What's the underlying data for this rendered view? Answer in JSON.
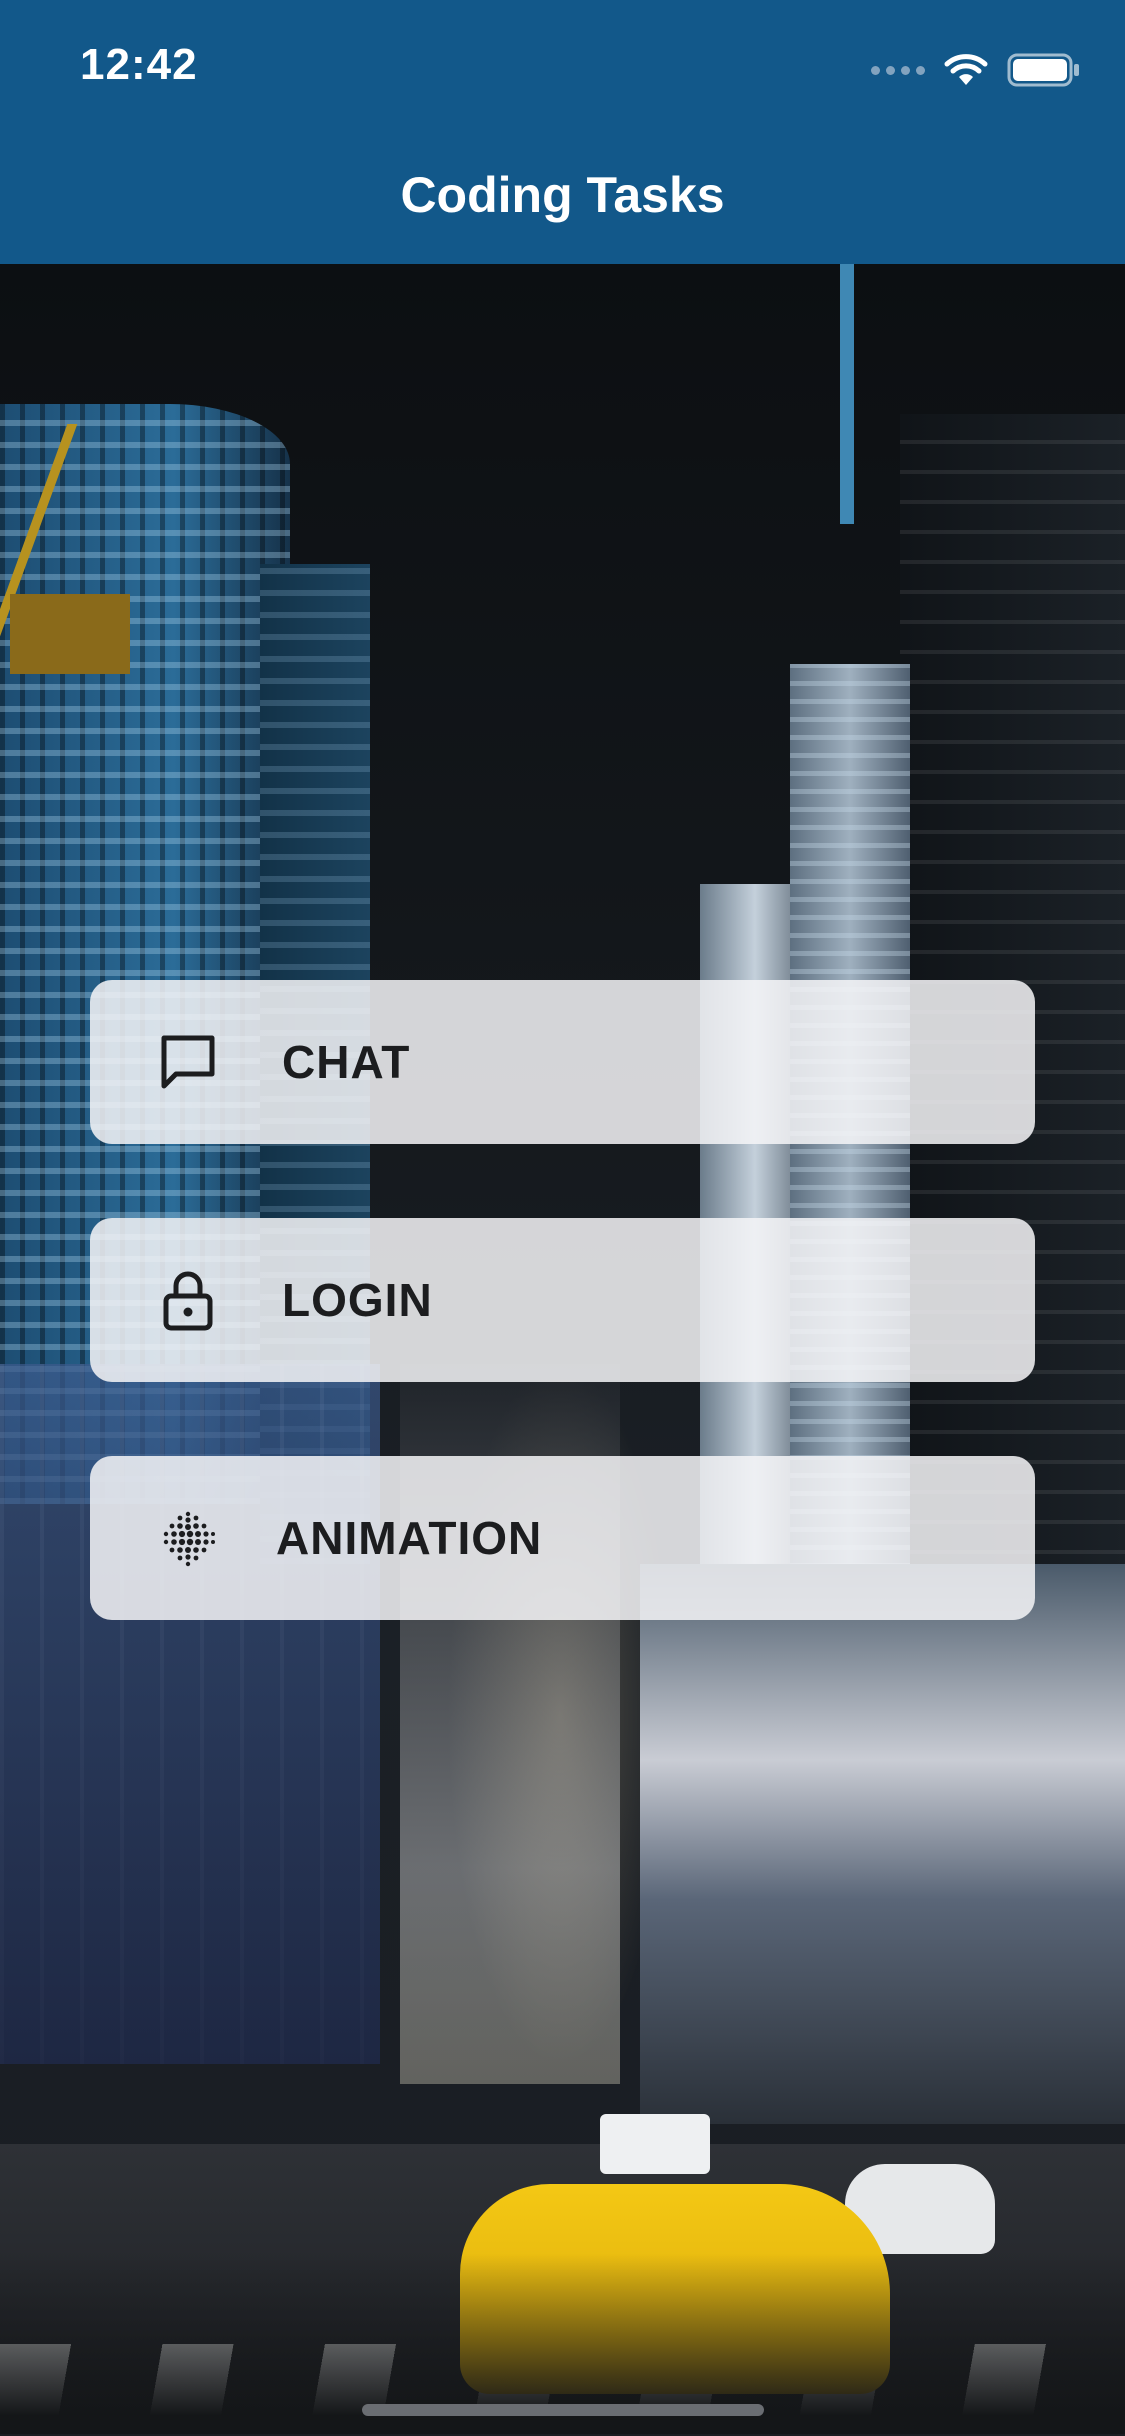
{
  "status_bar": {
    "time": "12:42"
  },
  "nav": {
    "title": "Coding Tasks"
  },
  "menu": {
    "items": [
      {
        "label": "CHAT",
        "icon": "chat-bubble-icon"
      },
      {
        "label": "LOGIN",
        "icon": "padlock-icon"
      },
      {
        "label": "ANIMATION",
        "icon": "dot-grid-icon"
      }
    ]
  },
  "colors": {
    "header_background": "#12588a",
    "button_background": "#f5f5f7",
    "button_text": "#1c1d1f"
  }
}
